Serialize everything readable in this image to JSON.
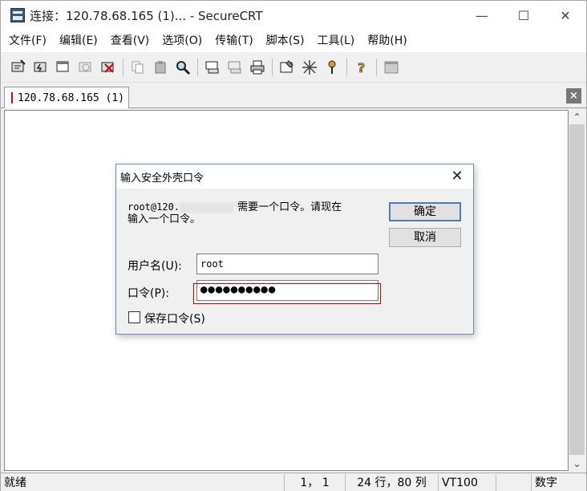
{
  "window": {
    "title": "连接：120.78.68.165 (1)... - SecureCRT",
    "controls": {
      "minimize": "—",
      "maximize": "☐",
      "close": "✕"
    }
  },
  "menu": [
    "文件(F)",
    "编辑(E)",
    "查看(V)",
    "选项(O)",
    "传输(T)",
    "脚本(S)",
    "工具(L)",
    "帮助(H)"
  ],
  "tab": {
    "label": "120.78.68.165 (1)",
    "close": "×"
  },
  "dialog": {
    "title": "输入安全外壳口令",
    "close": "✕",
    "message_prefix": "root@120.",
    "message_suffix": "需要一个口令。请现在",
    "message_line2": "输入一个口令。",
    "ok_label": "确定",
    "cancel_label": "取消",
    "username_label": "用户名(U):",
    "username_value": "root",
    "password_label": "口令(P):",
    "password_value": "●●●●●●●●●●",
    "save_password_label": "保存口令(S)"
  },
  "status": {
    "ready": "就绪",
    "cursor": "1， 1",
    "size": "24 行，80 列",
    "emulation": "VT100",
    "numlock": "数字"
  },
  "scrollbar": {
    "up": "⌃",
    "down": "⌄"
  }
}
